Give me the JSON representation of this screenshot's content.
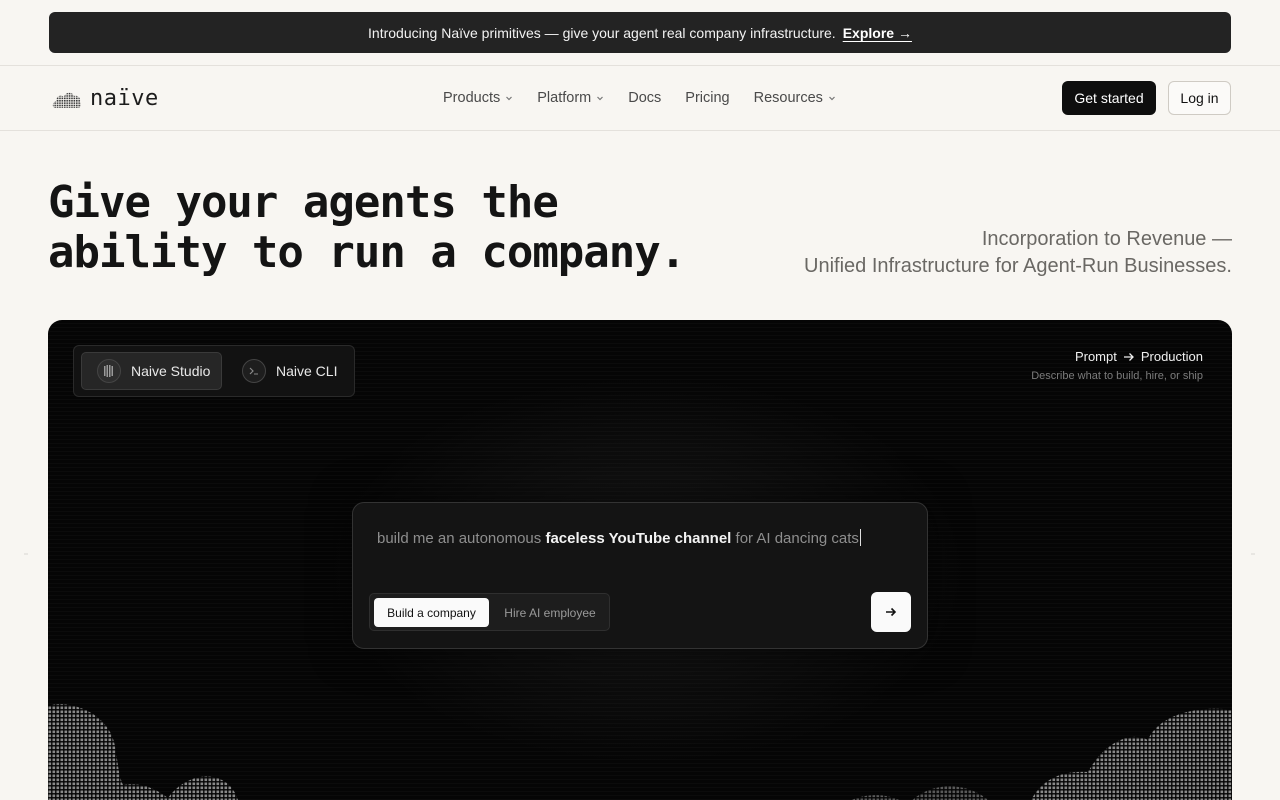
{
  "announcement": {
    "text": "Introducing Naïve primitives — give your agent real company infrastructure.",
    "cta": "Explore →"
  },
  "nav": {
    "logo_text": "naïve",
    "links": [
      {
        "label": "Products",
        "has_dropdown": true
      },
      {
        "label": "Platform",
        "has_dropdown": true
      },
      {
        "label": "Docs",
        "has_dropdown": false
      },
      {
        "label": "Pricing",
        "has_dropdown": false
      },
      {
        "label": "Resources",
        "has_dropdown": true
      }
    ],
    "get_started": "Get started",
    "login": "Log in"
  },
  "hero": {
    "title_line1": "Give your agents the",
    "title_line2": "ability to run a company.",
    "sub_line1": "Incorporation to Revenue —",
    "sub_line2": "Unified Infrastructure for Agent-Run Businesses."
  },
  "panel": {
    "tabs": [
      {
        "label": "Naive Studio",
        "active": true,
        "icon": "studio-grid-icon"
      },
      {
        "label": "Naive CLI",
        "active": false,
        "icon": "terminal-icon"
      }
    ],
    "prompt_from": "Prompt",
    "prompt_to": "Production",
    "prompt_desc": "Describe what to build, hire, or ship",
    "input": {
      "pre": "build me an autonomous ",
      "highlight": "faceless YouTube channel",
      "post": " for AI dancing cats"
    },
    "modes": [
      {
        "label": "Build a company",
        "active": true
      },
      {
        "label": "Hire AI employee",
        "active": false
      }
    ],
    "submit_icon": "arrow-right-icon"
  },
  "colors": {
    "page_bg": "#f8f6f2",
    "panel_bg": "#050505",
    "announce_bg": "#232323",
    "primary_button": "#0e0e0e"
  }
}
